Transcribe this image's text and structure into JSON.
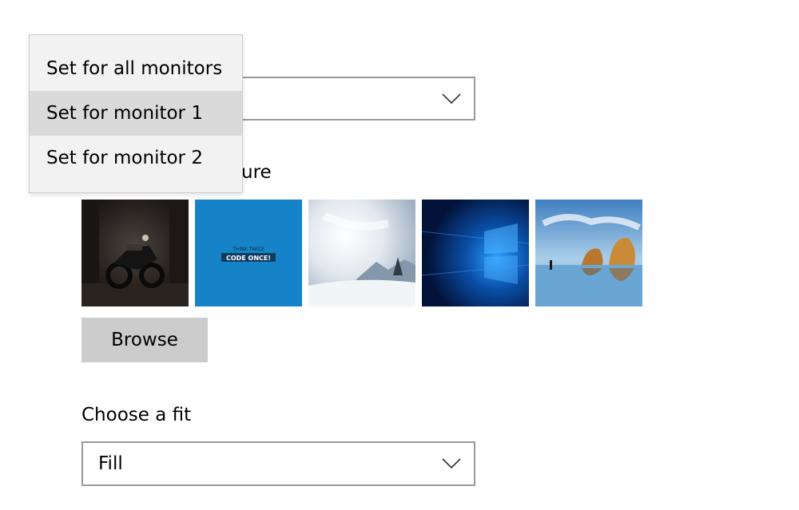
{
  "monitor_combo": {
    "value": ""
  },
  "flyout": {
    "items": [
      {
        "label": "Set for all monitors",
        "selected": false
      },
      {
        "label": "Set for monitor 1",
        "selected": true
      },
      {
        "label": "Set for monitor 2",
        "selected": false
      }
    ]
  },
  "picture_section": {
    "label_visible": "ure",
    "thumbnails": [
      {
        "name": "motorcycle-garage"
      },
      {
        "name": "code-once-blue",
        "text_top": "THINK TWICE",
        "text_main": "CODE ONCE!"
      },
      {
        "name": "snowy-mountain"
      },
      {
        "name": "windows-10-hero"
      },
      {
        "name": "beach-rocks"
      }
    ],
    "browse_label": "Browse"
  },
  "fit_section": {
    "label": "Choose a fit",
    "value": "Fill"
  },
  "colors": {
    "combo_border": "#999999",
    "flyout_bg": "#f2f2f2",
    "selected_bg": "#dadada",
    "button_bg": "#cccccc",
    "accent_blue": "#1683c9"
  }
}
